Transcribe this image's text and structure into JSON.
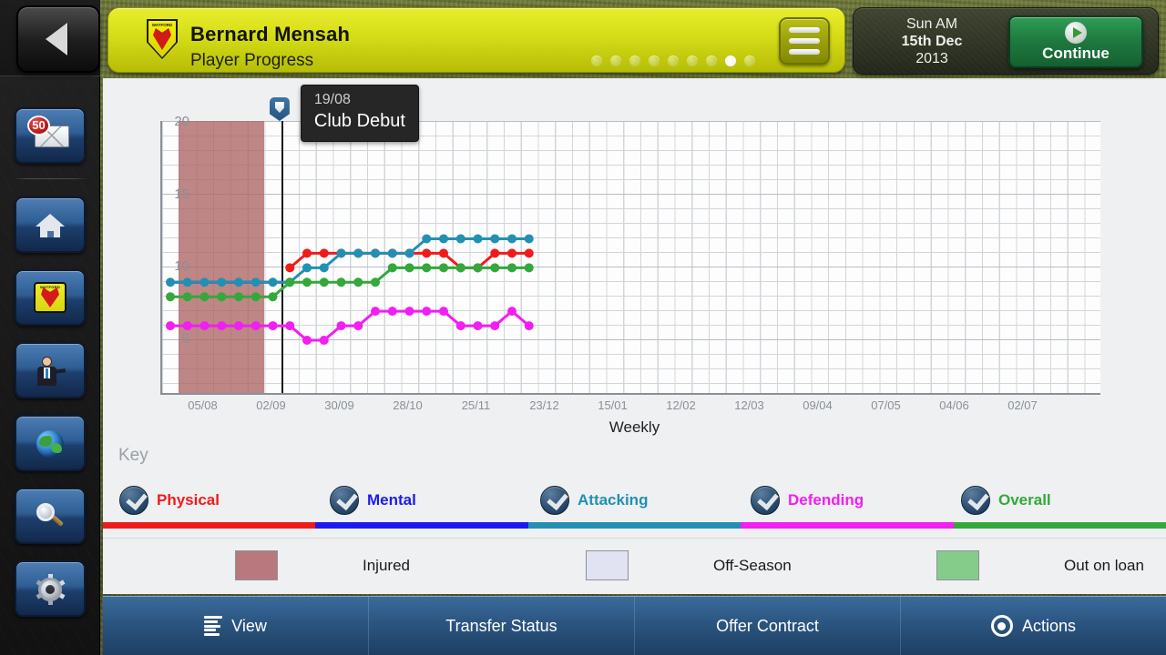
{
  "header": {
    "back_label": "Back",
    "player_name": "Bernard Mensah",
    "page_subtitle": "Player Progress",
    "club_crest_text": "WATFORD",
    "menu_label": "Menu",
    "page_dots_total": 9,
    "page_dots_active_index": 7,
    "date_line1": "Sun AM",
    "date_line2": "15th Dec",
    "date_line3": "2013",
    "continue_label": "Continue"
  },
  "sidebar": {
    "items": [
      {
        "name": "inbox-icon",
        "label": "Inbox",
        "badge": "50"
      },
      {
        "name": "home-icon",
        "label": "Home"
      },
      {
        "name": "club-crest-icon",
        "label": "Club"
      },
      {
        "name": "manager-icon",
        "label": "Manager"
      },
      {
        "name": "world-icon",
        "label": "World"
      },
      {
        "name": "search-icon",
        "label": "Search"
      },
      {
        "name": "settings-gear-icon",
        "label": "Settings"
      }
    ]
  },
  "chart_data": {
    "type": "line",
    "title": "Player Progress",
    "xlabel": "Weekly",
    "ylabel": "",
    "ylim": [
      0,
      20
    ],
    "yticks": [
      5,
      10,
      15,
      20
    ],
    "xticks": [
      "05/08",
      "02/09",
      "30/09",
      "28/10",
      "25/11",
      "23/12",
      "15/01",
      "12/02",
      "12/03",
      "09/04",
      "07/05",
      "04/06",
      "02/07"
    ],
    "grid": true,
    "legend_position": "bottom",
    "point_count": 22,
    "series": [
      {
        "name": "Physical",
        "color": "#ef1b1b",
        "values": [
          null,
          null,
          null,
          null,
          null,
          null,
          null,
          10,
          11,
          11,
          11,
          11,
          11,
          11,
          11,
          11,
          11,
          10,
          10,
          11,
          11,
          11
        ]
      },
      {
        "name": "Mental",
        "color": "#1b1bef",
        "values": [
          9,
          9,
          9,
          9,
          9,
          9,
          9,
          9,
          null,
          null,
          null,
          null,
          null,
          null,
          null,
          null,
          null,
          null,
          null,
          null,
          null,
          null
        ]
      },
      {
        "name": "Attacking",
        "color": "#2390b3",
        "values": [
          9,
          9,
          9,
          9,
          9,
          9,
          9,
          9,
          10,
          10,
          11,
          11,
          11,
          11,
          11,
          12,
          12,
          12,
          12,
          12,
          12,
          12
        ]
      },
      {
        "name": "Defending",
        "color": "#f21ef2",
        "values": [
          6,
          6,
          6,
          6,
          6,
          6,
          6,
          6,
          5,
          5,
          6,
          6,
          7,
          7,
          7,
          7,
          7,
          6,
          6,
          6,
          7,
          6
        ]
      },
      {
        "name": "Overall",
        "color": "#34a83a",
        "values": [
          8,
          8,
          8,
          8,
          8,
          8,
          8,
          9,
          9,
          9,
          9,
          9,
          9,
          10,
          10,
          10,
          10,
          10,
          10,
          10,
          10,
          10
        ]
      }
    ],
    "annotations": [
      {
        "date": "19/08",
        "label": "Club Debut",
        "type": "marker-pin"
      }
    ],
    "bands": [
      {
        "label": "Injured",
        "color": "#ad6464",
        "from_index": 1,
        "to_index": 5
      }
    ]
  },
  "key": {
    "title": "Key",
    "legend": [
      {
        "label": "Physical",
        "color": "#ef1b1b",
        "checked": true
      },
      {
        "label": "Mental",
        "color": "#1b1bef",
        "checked": true
      },
      {
        "label": "Attacking",
        "color": "#2390b3",
        "checked": true
      },
      {
        "label": "Defending",
        "color": "#f21ef2",
        "checked": true
      },
      {
        "label": "Overall",
        "color": "#34a83a",
        "checked": true
      }
    ],
    "statuses": [
      {
        "label": "Injured",
        "color": "#b9787d"
      },
      {
        "label": "Off-Season",
        "color": "#e2e3f2"
      },
      {
        "label": "Out on loan",
        "color": "#85cc8a"
      }
    ]
  },
  "toolbar": {
    "items": [
      {
        "label": "View",
        "icon": "list-lines-icon"
      },
      {
        "label": "Transfer Status",
        "icon": ""
      },
      {
        "label": "Offer Contract",
        "icon": ""
      },
      {
        "label": "Actions",
        "icon": "target-icon"
      }
    ]
  }
}
